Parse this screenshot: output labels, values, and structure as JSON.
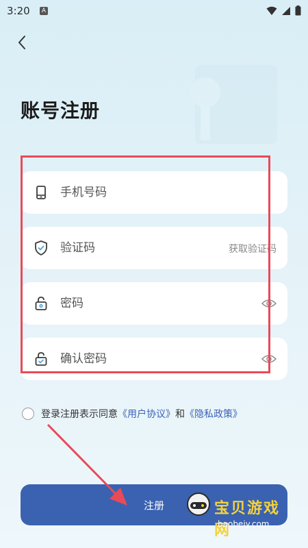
{
  "status_bar": {
    "time": "3:20",
    "app_icon_letter": "A"
  },
  "page": {
    "title": "账号注册"
  },
  "fields": {
    "phone": {
      "placeholder": "手机号码"
    },
    "code": {
      "placeholder": "验证码",
      "action": "获取验证码"
    },
    "password": {
      "placeholder": "密码"
    },
    "confirm": {
      "placeholder": "确认密码"
    }
  },
  "agreement": {
    "prefix": "登录注册表示同意",
    "user_agreement": "《用户协议》",
    "and": "和",
    "privacy_policy": "《隐私政策》"
  },
  "register_button": {
    "label": "注册"
  },
  "watermark": {
    "title": "宝贝游戏网",
    "url": "baobeiy.com"
  },
  "colors": {
    "accent": "#3a62b0",
    "link": "#3a62b8",
    "annotation": "#e84a58"
  }
}
